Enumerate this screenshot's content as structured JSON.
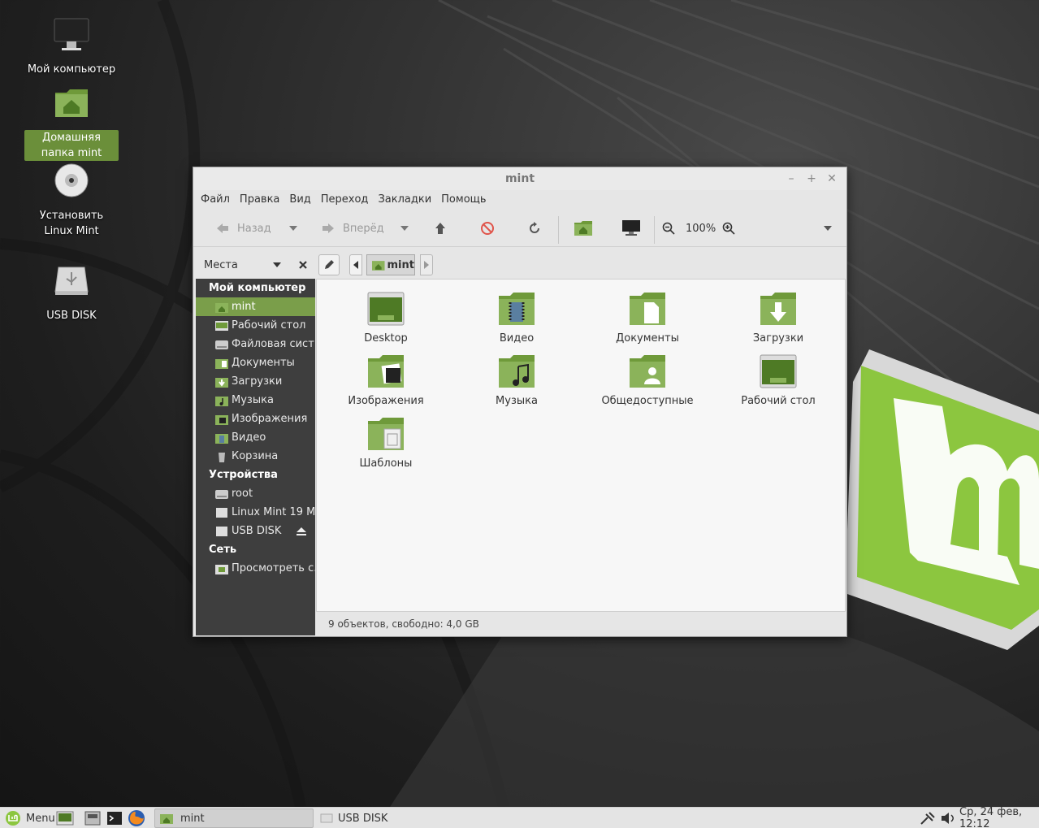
{
  "desktop": {
    "icons": [
      {
        "label": "Мой компьютер"
      },
      {
        "label": "Домашняя папка mint"
      },
      {
        "label": "Установить Linux Mint"
      },
      {
        "label": "USB DISK"
      }
    ]
  },
  "window": {
    "title": "mint",
    "controls": {
      "minimize": "–",
      "maximize": "+",
      "close": "✕"
    },
    "menu": [
      "Файл",
      "Правка",
      "Вид",
      "Переход",
      "Закладки",
      "Помощь"
    ],
    "toolbar": {
      "back_label": "Назад",
      "forward_label": "Вперёд",
      "zoom": "100%"
    },
    "sidebar_header": "Места",
    "path": {
      "current": "mint"
    },
    "sidebar": {
      "sections": [
        {
          "title": "Мой компьютер",
          "items": [
            "mint",
            "Рабочий стол",
            "Файловая сист...",
            "Документы",
            "Загрузки",
            "Музыка",
            "Изображения",
            "Видео",
            "Корзина"
          ]
        },
        {
          "title": "Устройства",
          "items": [
            "root",
            "Linux Mint 19 M...",
            "USB DISK"
          ]
        },
        {
          "title": "Сеть",
          "items": [
            "Просмотреть с..."
          ]
        }
      ]
    },
    "files": [
      "Desktop",
      "Видео",
      "Документы",
      "Загрузки",
      "Изображения",
      "Музыка",
      "Общедоступные",
      "Рабочий стол",
      "Шаблоны"
    ],
    "status": "9 объектов, свободно: 4,0 GB"
  },
  "taskbar": {
    "menu_label": "Menu",
    "windows": [
      "mint",
      "USB DISK"
    ],
    "clock": "Ср, 24 фев, 12:12"
  },
  "colors": {
    "accent": "#7a9e4a",
    "sidebar_bg": "#3e3e3e",
    "folder_green": "#8bb35a"
  }
}
